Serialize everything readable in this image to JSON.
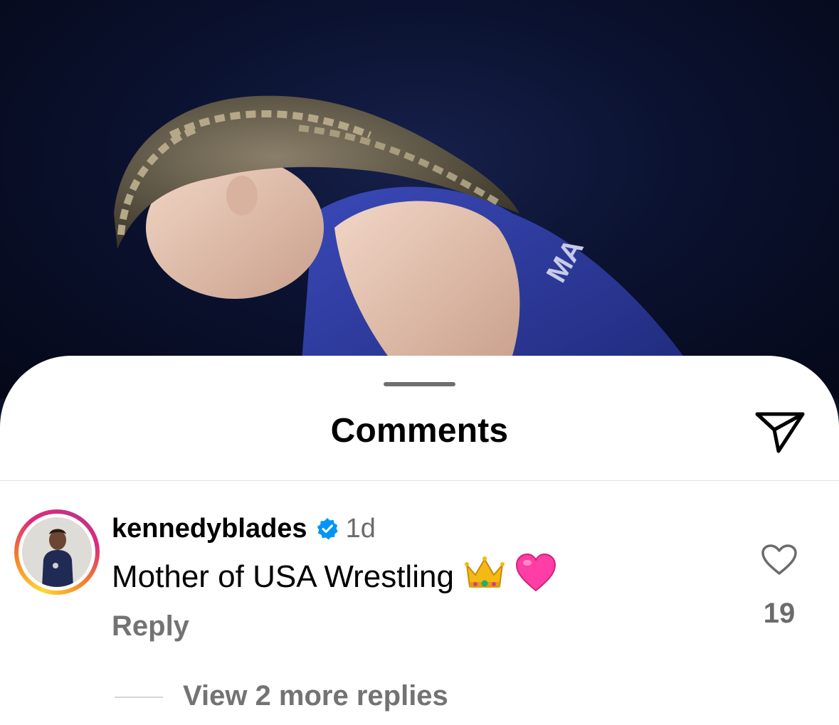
{
  "sheet": {
    "title": "Comments"
  },
  "icons": {
    "share": "paper-plane-icon",
    "like": "heart-outline-icon",
    "verified": "verified-badge-icon",
    "crown_emoji": "crown-emoji",
    "heart_emoji": "pink-heart-emoji"
  },
  "comment": {
    "username": "kennedyblades",
    "time": "1d",
    "text": "Mother of USA Wrestling",
    "emojis": [
      "👑",
      "💗"
    ],
    "reply_label": "Reply",
    "like_count": "19",
    "view_replies_label": "View 2 more replies"
  },
  "colors": {
    "verified_blue": "#0095f6",
    "heart_pink": "#ff3ea5",
    "secondary_text": "#737373"
  }
}
